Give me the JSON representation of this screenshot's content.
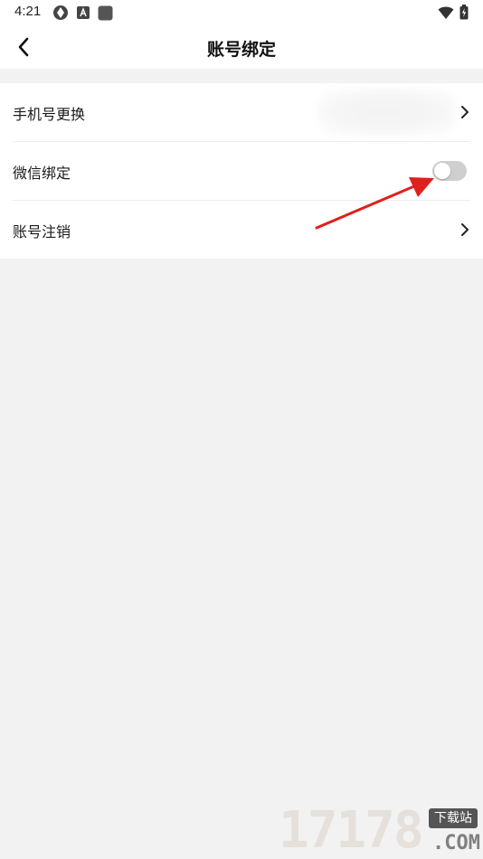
{
  "status_bar": {
    "time": "4:21",
    "left_icons": [
      "aperture-icon",
      "font-a-icon",
      "app-square-icon"
    ],
    "right_icons": [
      "wifi-icon",
      "battery-charging-icon"
    ]
  },
  "header": {
    "title": "账号绑定",
    "back_icon": "chevron-left-icon"
  },
  "settings": {
    "items": [
      {
        "label": "手机号更换",
        "value_hidden": true,
        "trailing": "chevron-right-icon"
      },
      {
        "label": "微信绑定",
        "trailing": "toggle",
        "toggle_on": false
      },
      {
        "label": "账号注销",
        "trailing": "chevron-right-icon"
      }
    ]
  },
  "colors": {
    "page_background": "#f2f2f2",
    "card_background": "#ffffff",
    "toggle_off": "#cfcfcf",
    "annotation_arrow": "#e0201c"
  },
  "watermark": {
    "digits": "17178",
    "tag": "下载站",
    "domain": ".COM"
  }
}
